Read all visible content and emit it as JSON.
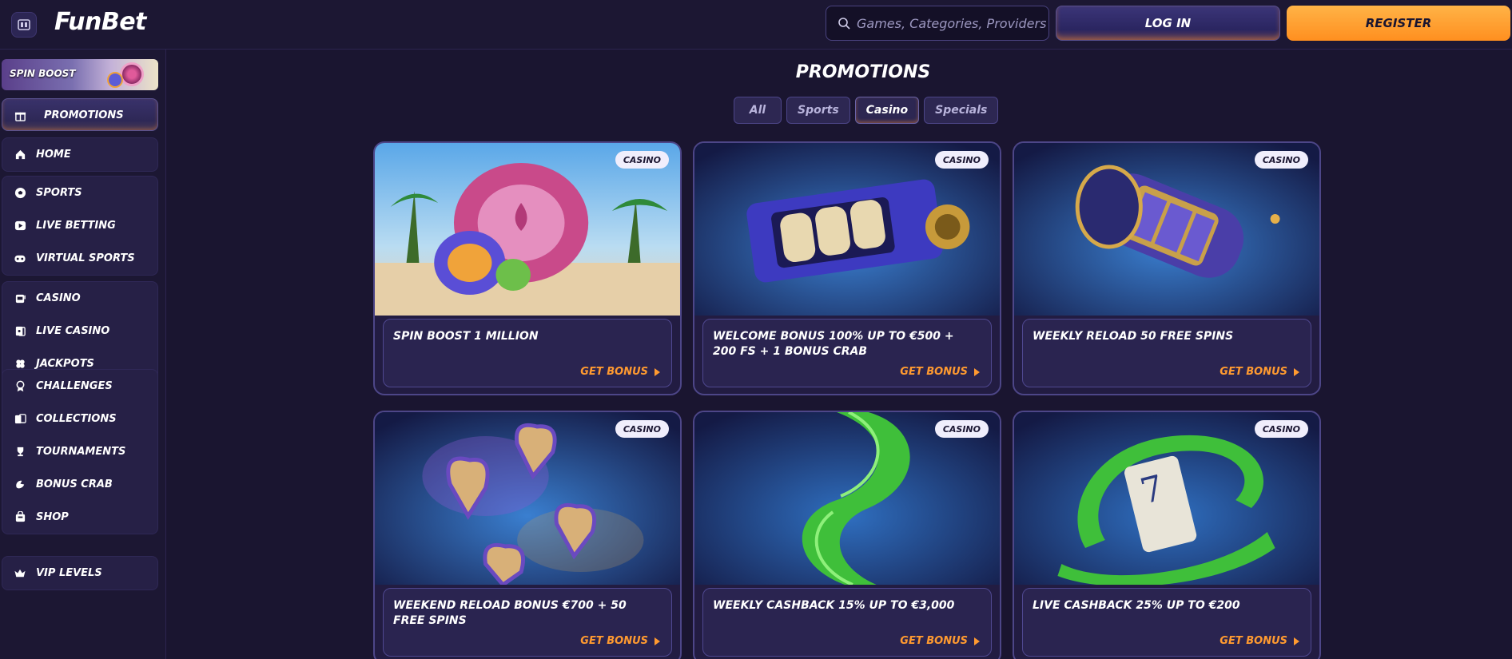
{
  "brand": {
    "logo_text": "FunBet"
  },
  "header": {
    "search_placeholder": "Games, Categories, Providers",
    "login_label": "LOG IN",
    "register_label": "REGISTER"
  },
  "sidebar": {
    "spin_boost_label": "SPIN BOOST",
    "promotions_label": "PROMOTIONS",
    "home_label": "HOME",
    "sports_group": [
      "SPORTS",
      "LIVE BETTING",
      "VIRTUAL SPORTS"
    ],
    "casino_group": [
      "CASINO",
      "LIVE CASINO",
      "JACKPOTS"
    ],
    "extras_group": [
      "CHALLENGES",
      "COLLECTIONS",
      "TOURNAMENTS",
      "BONUS CRAB",
      "SHOP"
    ],
    "vip_label": "VIP LEVELS"
  },
  "main": {
    "title": "PROMOTIONS",
    "filters": [
      "All",
      "Sports",
      "Casino",
      "Specials"
    ],
    "active_filter": "Casino"
  },
  "cards": [
    {
      "badge": "CASINO",
      "title": "SPIN BOOST 1 MILLION",
      "cta": "GET BONUS"
    },
    {
      "badge": "CASINO",
      "title": "WELCOME BONUS 100% UP TO €500 + 200 FS + 1 BONUS CRAB",
      "cta": "GET BONUS"
    },
    {
      "badge": "CASINO",
      "title": "WEEKLY RELOAD 50 FREE SPINS",
      "cta": "GET BONUS"
    },
    {
      "badge": "CASINO",
      "title": "WEEKEND RELOAD BONUS €700 + 50 FREE SPINS",
      "cta": "GET BONUS"
    },
    {
      "badge": "CASINO",
      "title": "WEEKLY CASHBACK 15% UP TO €3,000",
      "cta": "GET BONUS"
    },
    {
      "badge": "CASINO",
      "title": "LIVE CASHBACK 25% UP TO €200",
      "cta": "GET BONUS"
    }
  ],
  "colors": {
    "accent_orange": "#ff9a30",
    "background": "#1a1530",
    "panel": "#262046"
  }
}
